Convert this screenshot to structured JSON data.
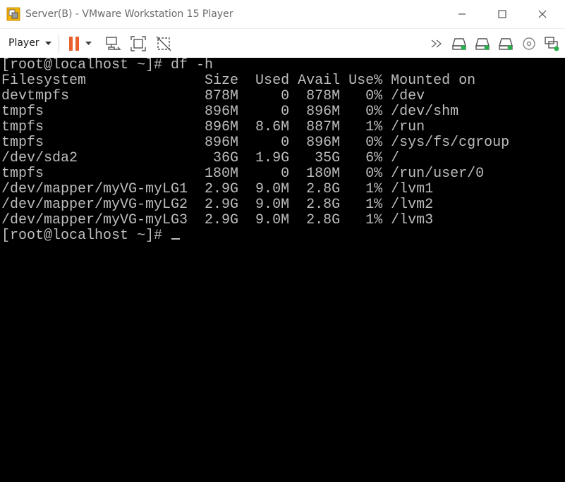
{
  "window": {
    "title": "Server(B) - VMware Workstation 15 Player",
    "app_icon": "vmware-player-icon",
    "controls": [
      "minimize-icon",
      "maximize-icon",
      "close-icon"
    ]
  },
  "toolbar": {
    "player_menu_label": "Player",
    "left_icons": [
      "pause-icon",
      "dropdown-caret-icon",
      "send-ctrl-alt-del-icon",
      "fit-guest-icon",
      "unity-icon"
    ],
    "device_icons": [
      "more-devices-icon",
      "hard-disk-1-icon",
      "hard-disk-2-icon",
      "hard-disk-3-icon",
      "cd-dvd-icon",
      "network-adapter-icon"
    ],
    "accent_color": "#e8612c",
    "device_active_color": "#28b04a"
  },
  "terminal": {
    "background": "#000000",
    "foreground": "#bdbdbd",
    "prompt_command": "[root@localhost ~]# df -h",
    "header": {
      "filesystem": "Filesystem",
      "size": "Size",
      "used": "Used",
      "avail": "Avail",
      "use_pct": "Use%",
      "mounted_on": "Mounted on"
    },
    "rows": [
      {
        "filesystem": "devtmpfs",
        "size": "878M",
        "used": "0",
        "avail": "878M",
        "use_pct": "0%",
        "mounted_on": "/dev"
      },
      {
        "filesystem": "tmpfs",
        "size": "896M",
        "used": "0",
        "avail": "896M",
        "use_pct": "0%",
        "mounted_on": "/dev/shm"
      },
      {
        "filesystem": "tmpfs",
        "size": "896M",
        "used": "8.6M",
        "avail": "887M",
        "use_pct": "1%",
        "mounted_on": "/run"
      },
      {
        "filesystem": "tmpfs",
        "size": "896M",
        "used": "0",
        "avail": "896M",
        "use_pct": "0%",
        "mounted_on": "/sys/fs/cgroup"
      },
      {
        "filesystem": "/dev/sda2",
        "size": "36G",
        "used": "1.9G",
        "avail": "35G",
        "use_pct": "6%",
        "mounted_on": "/"
      },
      {
        "filesystem": "tmpfs",
        "size": "180M",
        "used": "0",
        "avail": "180M",
        "use_pct": "0%",
        "mounted_on": "/run/user/0"
      },
      {
        "filesystem": "/dev/mapper/myVG-myLG1",
        "size": "2.9G",
        "used": "9.0M",
        "avail": "2.8G",
        "use_pct": "1%",
        "mounted_on": "/lvm1"
      },
      {
        "filesystem": "/dev/mapper/myVG-myLG2",
        "size": "2.9G",
        "used": "9.0M",
        "avail": "2.8G",
        "use_pct": "1%",
        "mounted_on": "/lvm2"
      },
      {
        "filesystem": "/dev/mapper/myVG-myLG3",
        "size": "2.9G",
        "used": "9.0M",
        "avail": "2.8G",
        "use_pct": "1%",
        "mounted_on": "/lvm3"
      }
    ],
    "final_prompt": "[root@localhost ~]# "
  }
}
